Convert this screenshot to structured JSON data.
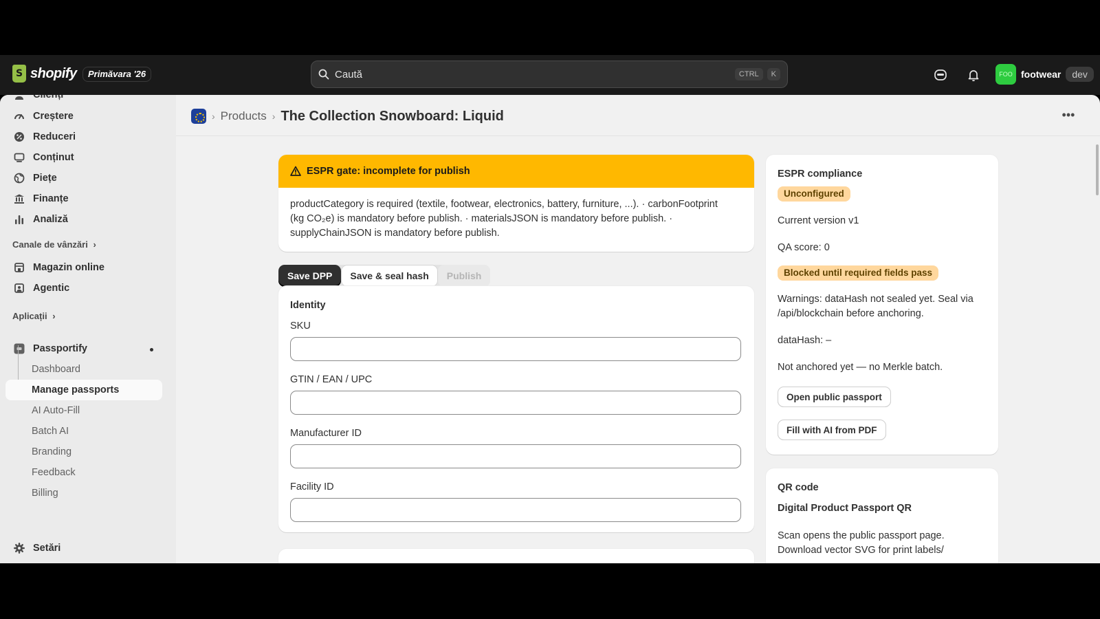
{
  "topbar": {
    "logo_text": "shopify",
    "season_badge": "Primăvara '26",
    "search_placeholder": "Caută",
    "shortcut_ctrl": "CTRL",
    "shortcut_k": "K",
    "store_avatar": "FOO",
    "store_name": "footwear",
    "env_badge": "dev"
  },
  "sidebar": {
    "items": [
      {
        "label": "Clienți",
        "icon": "person-icon"
      },
      {
        "label": "Creștere",
        "icon": "gauge-icon"
      },
      {
        "label": "Reduceri",
        "icon": "discount-icon"
      },
      {
        "label": "Conținut",
        "icon": "content-icon"
      },
      {
        "label": "Piețe",
        "icon": "globe-icon"
      },
      {
        "label": "Finanțe",
        "icon": "bank-icon"
      },
      {
        "label": "Analiză",
        "icon": "bar-chart-icon"
      }
    ],
    "sales_channels_heading": "Canale de vânzări",
    "channels": [
      {
        "label": "Magazin online",
        "icon": "store-icon"
      },
      {
        "label": "Agentic",
        "icon": "agentic-icon"
      }
    ],
    "apps_heading": "Aplicații",
    "app_name": "Passportify",
    "app_subitems": [
      "Dashboard",
      "Manage passports",
      "AI Auto-Fill",
      "Batch AI",
      "Branding",
      "Feedback",
      "Billing"
    ],
    "active_subitem": "Manage passports",
    "settings_label": "Setări"
  },
  "header": {
    "breadcrumb_link": "Products",
    "title": "The Collection Snowboard: Liquid"
  },
  "banner": {
    "title": "ESPR gate: incomplete for publish",
    "message": "productCategory is required (textile, footwear, electronics, battery, furniture, ...). · carbonFootprint (kg CO₂e) is mandatory before publish. · materialsJSON is mandatory before publish. · supplyChainJSON is mandatory before publish."
  },
  "actions": {
    "save": "Save DPP",
    "seal": "Save & seal hash",
    "publish": "Publish"
  },
  "identity": {
    "title": "Identity",
    "fields": [
      {
        "label": "SKU",
        "value": ""
      },
      {
        "label": "GTIN / EAN / UPC",
        "value": ""
      },
      {
        "label": "Manufacturer ID",
        "value": ""
      },
      {
        "label": "Facility ID",
        "value": ""
      }
    ]
  },
  "compliance": {
    "title": "ESPR compliance",
    "status_badge": "Unconfigured",
    "version": "Current version v1",
    "qa_score": "QA score: 0",
    "blocked_badge": "Blocked until required fields pass",
    "warnings": "Warnings: dataHash not sealed yet. Seal via /api/blockchain before anchoring.",
    "data_hash": "dataHash: –",
    "anchor_status": "Not anchored yet — no Merkle batch.",
    "open_passport": "Open public passport",
    "fill_ai": "Fill with AI from PDF"
  },
  "qr": {
    "title": "QR code",
    "subtitle": "Digital Product Passport QR",
    "description": "Scan opens the public passport page. Download vector SVG for print labels/"
  },
  "colors": {
    "banner_bg": "#ffb800",
    "badge_bg": "#ffd79d",
    "topbar_bg": "#1a1a1a",
    "store_avatar_bg": "#2ecc40"
  }
}
